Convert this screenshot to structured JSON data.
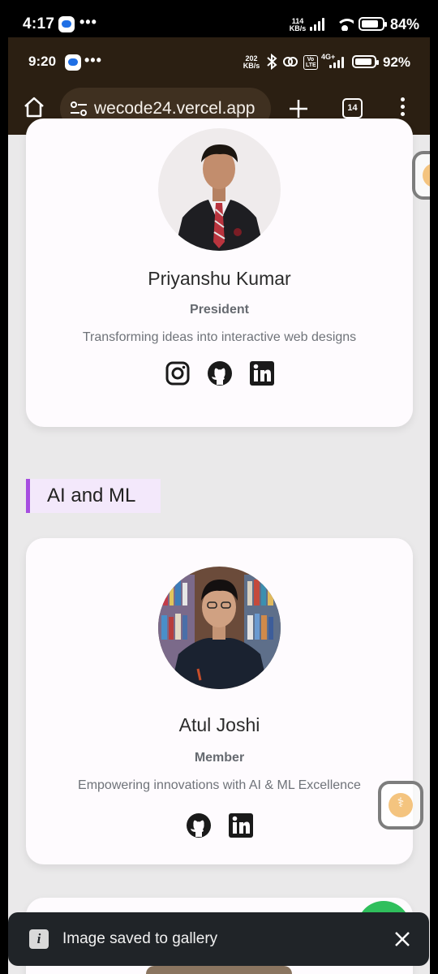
{
  "outer_status": {
    "time": "4:17",
    "net_speed_value": "114",
    "net_speed_unit": "KB/s",
    "battery": "84%",
    "battery_level": 0.84,
    "more_label": "•••"
  },
  "inner_status": {
    "time": "9:20",
    "net_speed_value": "202",
    "net_speed_unit": "KB/s",
    "network": "4G+",
    "volte": "Vo LTE",
    "battery": "92%",
    "battery_level": 0.92,
    "more_label": "•••"
  },
  "browser": {
    "url": "wecode24.vercel.app",
    "tab_count": "14",
    "icons": [
      "home-icon",
      "site-settings-icon",
      "new-tab-icon",
      "tabs-icon",
      "more-menu-icon"
    ]
  },
  "members": [
    {
      "name": "Priyanshu Kumar",
      "role": "President",
      "description": "Transforming ideas into interactive web designs",
      "socials": [
        "instagram",
        "github",
        "linkedin"
      ]
    },
    {
      "name": "Atul Joshi",
      "role": "Member",
      "description": "Empowering innovations with AI & ML Excellence",
      "socials": [
        "github",
        "linkedin"
      ]
    }
  ],
  "section": {
    "heading": "AI and ML",
    "accent_color": "#a64ee0"
  },
  "toast": {
    "message": "Image saved to gallery",
    "info_label": "i"
  },
  "colors": {
    "browser_bar": "#2b1f12",
    "page_background": "#eae9ea",
    "card_background": "#fefbfe",
    "toast_background": "#202428",
    "fab_green": "#2fbf5c"
  }
}
